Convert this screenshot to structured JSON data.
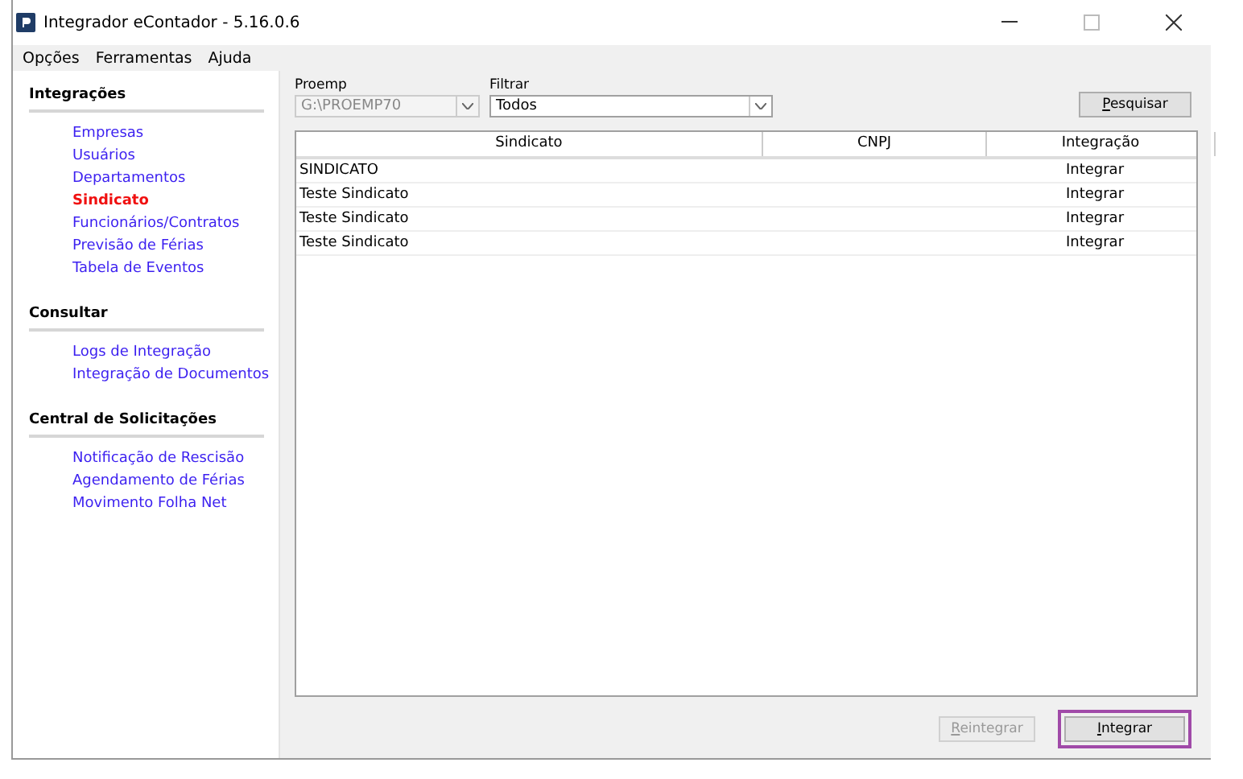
{
  "window": {
    "title": "Integrador eContador - 5.16.0.6"
  },
  "menu": [
    "Opções",
    "Ferramentas",
    "Ajuda"
  ],
  "sidebar": [
    {
      "title": "Integrações",
      "items": [
        {
          "label": "Empresas",
          "selected": false
        },
        {
          "label": "Usuários",
          "selected": false
        },
        {
          "label": "Departamentos",
          "selected": false
        },
        {
          "label": "Sindicato",
          "selected": true
        },
        {
          "label": "Funcionários/Contratos",
          "selected": false
        },
        {
          "label": "Previsão de Férias",
          "selected": false
        },
        {
          "label": "Tabela de Eventos",
          "selected": false
        }
      ]
    },
    {
      "title": "Consultar",
      "items": [
        {
          "label": "Logs de Integração",
          "selected": false
        },
        {
          "label": "Integração de Documentos",
          "selected": false
        }
      ]
    },
    {
      "title": "Central de Solicitações",
      "items": [
        {
          "label": "Notificação de Rescisão",
          "selected": false
        },
        {
          "label": "Agendamento de Férias",
          "selected": false
        },
        {
          "label": "Movimento Folha Net",
          "selected": false
        }
      ]
    }
  ],
  "proemp": {
    "label": "Proemp",
    "value": "G:\\PROEMP70",
    "disabled": true
  },
  "filtrar": {
    "label": "Filtrar",
    "value": "Todos",
    "disabled": false
  },
  "search_button": {
    "label": "Pesquisar"
  },
  "table": {
    "columns": [
      "Sindicato",
      "CNPJ",
      "Integração"
    ],
    "rows": [
      [
        "SINDICATO",
        "",
        "Integrar"
      ],
      [
        "Teste Sindicato",
        "",
        "Integrar"
      ],
      [
        "Teste Sindicato",
        "",
        "Integrar"
      ],
      [
        "Teste Sindicato",
        "",
        "Integrar"
      ]
    ]
  },
  "buttons": [
    {
      "label": "Reintegrar",
      "disabled": true,
      "highlighted": false
    },
    {
      "label": "Integrar",
      "disabled": false,
      "highlighted": true
    }
  ]
}
